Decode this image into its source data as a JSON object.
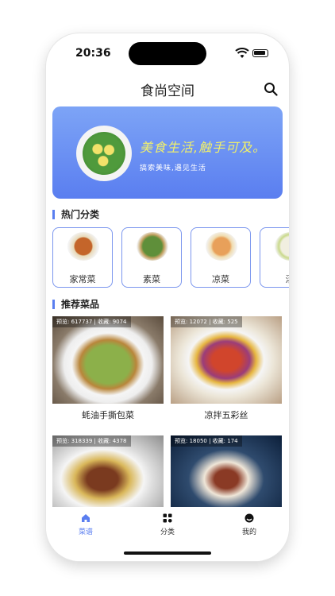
{
  "status_bar": {
    "time": "20:36"
  },
  "header": {
    "title": "食尚空间",
    "search_icon": "search-icon"
  },
  "banner": {
    "headline": "美食生活,触手可及。",
    "tagline": "搞索美味,遇见生活"
  },
  "sections": {
    "hot_categories": "热门分类",
    "recommended": "推荐菜品"
  },
  "categories": [
    {
      "label": "家常菜"
    },
    {
      "label": "素菜"
    },
    {
      "label": "凉菜"
    },
    {
      "label": "汤"
    }
  ],
  "dishes": [
    {
      "stats": "预览: 617737 | 收藏: 9074",
      "name": "蚝油手撕包菜"
    },
    {
      "stats": "预览: 12072 | 收藏: 525",
      "name": "凉拌五彩丝"
    },
    {
      "stats": "预览: 318339 | 收藏: 4378",
      "name": ""
    },
    {
      "stats": "预览: 18050 | 收藏: 174",
      "name": ""
    }
  ],
  "tabbar": {
    "items": [
      {
        "label": "菜谱",
        "icon": "home-icon",
        "active": true
      },
      {
        "label": "分类",
        "icon": "grid-icon",
        "active": false
      },
      {
        "label": "我的",
        "icon": "profile-icon",
        "active": false
      }
    ]
  },
  "colors": {
    "accent": "#5a7ef0",
    "banner_text": "#f1f06a"
  }
}
